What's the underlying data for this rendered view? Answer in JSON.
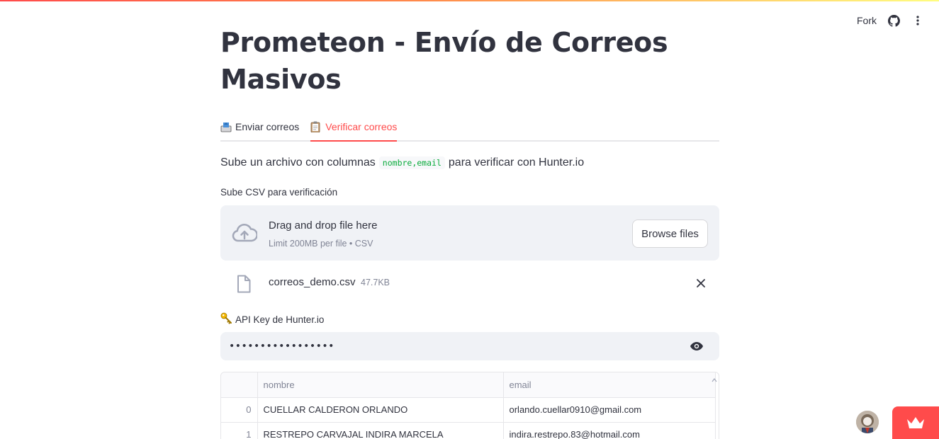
{
  "toolbar": {
    "fork_label": "Fork"
  },
  "page": {
    "title": "Prometeon - Envío de Correos Masivos"
  },
  "tabs": [
    {
      "label": "Enviar correos",
      "icon": "outbox-tray-icon",
      "active": false
    },
    {
      "label": "Verificar correos",
      "icon": "clipboard-icon",
      "active": true
    }
  ],
  "intro": {
    "before": "Sube un archivo con columnas",
    "code": "nombre,email",
    "after": "para verificar con Hunter.io"
  },
  "uploader": {
    "label": "Sube CSV para verificación",
    "title": "Drag and drop file here",
    "subtitle": "Limit 200MB per file • CSV",
    "browse_label": "Browse files"
  },
  "file": {
    "name": "correos_demo.csv",
    "size": "47.7KB"
  },
  "api": {
    "label": "API Key de Hunter.io",
    "value": "•••••••••••••••••"
  },
  "table": {
    "columns": [
      "",
      "nombre",
      "email"
    ],
    "rows": [
      {
        "index": "0",
        "nombre": "CUELLAR CALDERON ORLANDO",
        "email": "orlando.cuellar0910@gmail.com"
      },
      {
        "index": "1",
        "nombre": "RESTREPO CARVAJAL INDIRA MARCELA",
        "email": "indira.restrepo.83@hotmail.com"
      }
    ]
  },
  "colors": {
    "accent": "#ff4b4b",
    "code_green": "#09ab3b",
    "surface": "#f0f2f6",
    "text": "#31333f",
    "muted": "#808495"
  }
}
